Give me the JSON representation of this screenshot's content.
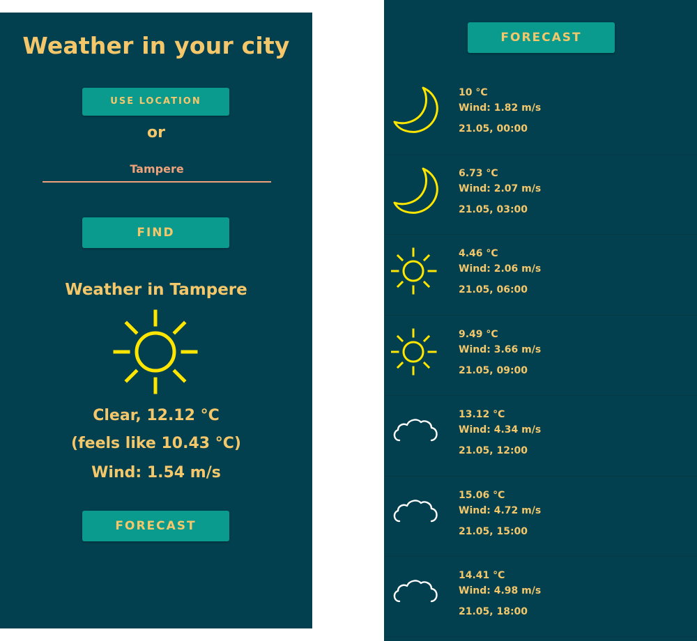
{
  "app": {
    "title": "Weather in your city",
    "use_location_label": "USE LOCATION",
    "or_label": "or",
    "city_input_value": "Tampere",
    "find_label": "FIND",
    "weather_heading": "Weather in Tampere",
    "current": {
      "icon": "sun-icon",
      "description": "Clear, 12.12 °C",
      "feels_like": "(feels like 10.43 °C)",
      "wind": "Wind: 1.54 m/s"
    },
    "forecast_label": "FORECAST"
  },
  "forecast": {
    "button_label": "FORECAST",
    "items": [
      {
        "icon": "moon-icon",
        "temp": "10 °C",
        "wind": "Wind: 1.82 m/s",
        "time": "21.05, 00:00"
      },
      {
        "icon": "moon-icon",
        "temp": "6.73 °C",
        "wind": "Wind: 2.07 m/s",
        "time": "21.05, 03:00"
      },
      {
        "icon": "sun-icon",
        "temp": "4.46 °C",
        "wind": "Wind: 2.06 m/s",
        "time": "21.05, 06:00"
      },
      {
        "icon": "sun-icon",
        "temp": "9.49 °C",
        "wind": "Wind: 3.66 m/s",
        "time": "21.05, 09:00"
      },
      {
        "icon": "cloud-icon",
        "temp": "13.12 °C",
        "wind": "Wind: 4.34 m/s",
        "time": "21.05, 12:00"
      },
      {
        "icon": "cloud-icon",
        "temp": "15.06 °C",
        "wind": "Wind: 4.72 m/s",
        "time": "21.05, 15:00"
      },
      {
        "icon": "cloud-icon",
        "temp": "14.41 °C",
        "wind": "Wind: 4.98 m/s",
        "time": "21.05, 18:00"
      }
    ]
  },
  "colors": {
    "background": "#02404f",
    "accent_text": "#f5c76b",
    "button": "#0a9b8e",
    "input_text": "#f0a27a",
    "icon_sun_moon": "#ffe600",
    "icon_cloud": "#ffffff"
  }
}
